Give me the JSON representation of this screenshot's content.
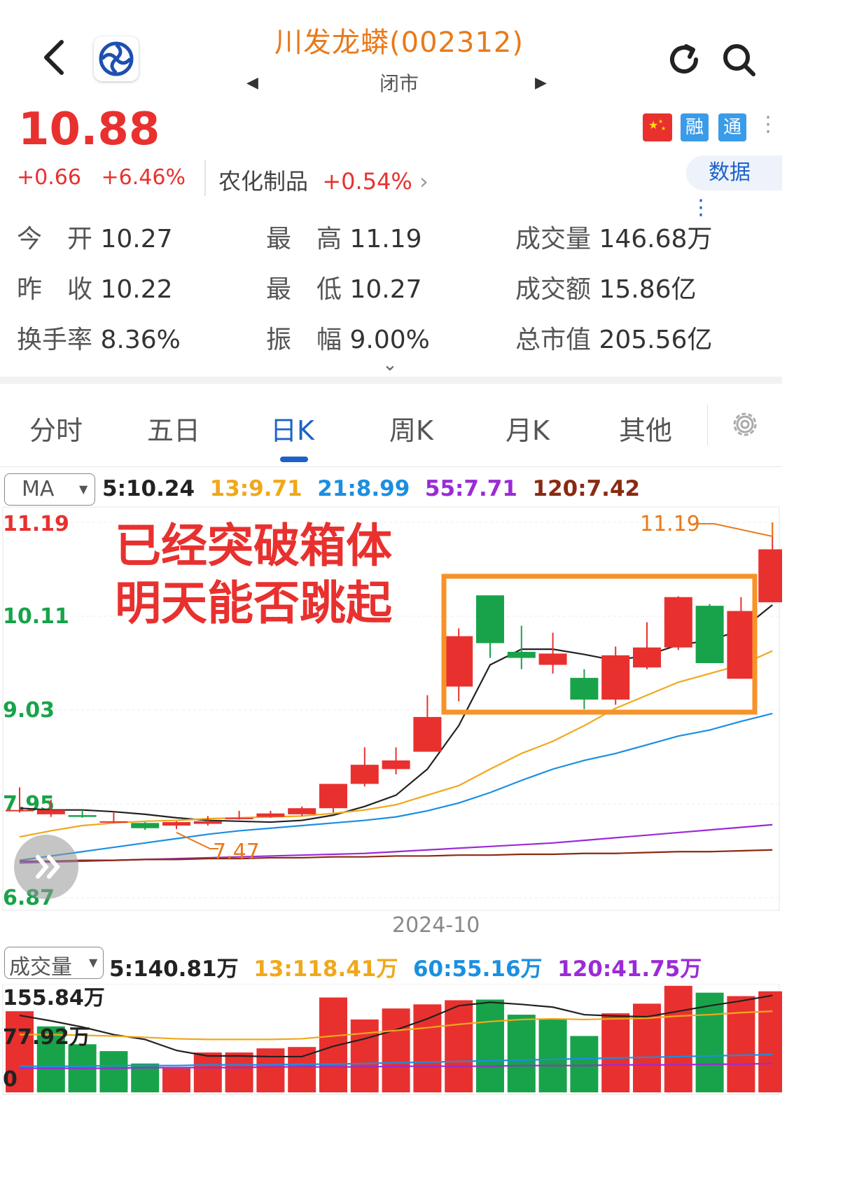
{
  "header": {
    "title": "川发龙蟒(002312)",
    "status": "闭市",
    "prev_arrow": "◀",
    "next_arrow": "▶"
  },
  "quote": {
    "price": "10.88",
    "change": "+0.66",
    "change_pct": "+6.46%",
    "sector_name": "农化制品",
    "sector_pct": "+0.54%",
    "sector_arrow": "›"
  },
  "badges": {
    "rong": "融",
    "tong": "通",
    "more": "⋮"
  },
  "data_button": {
    "label": "数据",
    "icon": "⋮"
  },
  "stats": [
    {
      "label": "今　开",
      "value": "10.27"
    },
    {
      "label": "最　高",
      "value": "11.19"
    },
    {
      "label": "成交量",
      "value": "146.68万"
    },
    {
      "label": "昨　收",
      "value": "10.22"
    },
    {
      "label": "最　低",
      "value": "10.27"
    },
    {
      "label": "成交额",
      "value": "15.86亿"
    },
    {
      "label": "换手率",
      "value": "8.36%"
    },
    {
      "label": "振　幅",
      "value": "9.00%"
    },
    {
      "label": "总市值",
      "value": "205.56亿"
    }
  ],
  "expand_chevron": "⌄",
  "tabs": [
    "分时",
    "五日",
    "日K",
    "周K",
    "月K",
    "其他"
  ],
  "ma_selector": {
    "label": "MA",
    "caret": "▼"
  },
  "ma_values": [
    {
      "text": "5:10.24",
      "color": "#222222"
    },
    {
      "text": "13:9.71",
      "color": "#f0a81b"
    },
    {
      "text": "21:8.99",
      "color": "#1b8fe0"
    },
    {
      "text": "55:7.71",
      "color": "#9b2bd6"
    },
    {
      "text": "120:7.42",
      "color": "#8a2a12"
    }
  ],
  "annotation": {
    "line1": "已经突破箱体",
    "line2": "明天能否跳起"
  },
  "date_label": "2024-10",
  "vol_selector": {
    "label": "成交量",
    "caret": "▼"
  },
  "vol_ma_values": [
    {
      "text": "5:140.81万",
      "color": "#222222"
    },
    {
      "text": "13:118.41万",
      "color": "#f0a81b"
    },
    {
      "text": "60:55.16万",
      "color": "#1b8fe0"
    },
    {
      "text": "120:41.75万",
      "color": "#9b2bd6"
    }
  ],
  "colors": {
    "up": "#e8312f",
    "down": "#18a34a",
    "box": "#f7922a",
    "accent": "#1e62c8"
  },
  "chart_data": {
    "type": "candlestick",
    "y_axis_labels": [
      "11.19",
      "10.11",
      "9.03",
      "7.95",
      "6.87"
    ],
    "ylim": [
      6.87,
      11.19
    ],
    "high_label": "11.19",
    "low_label": "7.47",
    "candles": [
      {
        "o": 7.88,
        "c": 7.88,
        "h": 8.14,
        "l": 7.85
      },
      {
        "o": 7.83,
        "c": 7.88,
        "h": 8.0,
        "l": 7.8
      },
      {
        "o": 7.82,
        "c": 7.8,
        "h": 7.88,
        "l": 7.79
      },
      {
        "o": 7.75,
        "c": 7.75,
        "h": 7.86,
        "l": 7.73
      },
      {
        "o": 7.73,
        "c": 7.67,
        "h": 7.74,
        "l": 7.65
      },
      {
        "o": 7.7,
        "c": 7.74,
        "h": 7.75,
        "l": 7.66
      },
      {
        "o": 7.72,
        "c": 7.75,
        "h": 7.81,
        "l": 7.7
      },
      {
        "o": 7.78,
        "c": 7.79,
        "h": 7.87,
        "l": 7.77
      },
      {
        "o": 7.8,
        "c": 7.84,
        "h": 7.87,
        "l": 7.79
      },
      {
        "o": 7.83,
        "c": 7.9,
        "h": 7.92,
        "l": 7.81
      },
      {
        "o": 7.9,
        "c": 8.18,
        "h": 8.18,
        "l": 7.85
      },
      {
        "o": 8.18,
        "c": 8.4,
        "h": 8.6,
        "l": 8.15
      },
      {
        "o": 8.35,
        "c": 8.45,
        "h": 8.6,
        "l": 8.29
      },
      {
        "o": 8.55,
        "c": 8.95,
        "h": 9.2,
        "l": 8.55
      },
      {
        "o": 9.3,
        "c": 9.88,
        "h": 9.97,
        "l": 9.13
      },
      {
        "o": 10.35,
        "c": 9.8,
        "h": 10.35,
        "l": 9.63
      },
      {
        "o": 9.7,
        "c": 9.63,
        "h": 10.0,
        "l": 9.5
      },
      {
        "o": 9.55,
        "c": 9.68,
        "h": 9.92,
        "l": 9.45
      },
      {
        "o": 9.4,
        "c": 9.15,
        "h": 9.5,
        "l": 9.04
      },
      {
        "o": 9.15,
        "c": 9.66,
        "h": 9.76,
        "l": 9.09
      },
      {
        "o": 9.52,
        "c": 9.75,
        "h": 10.04,
        "l": 9.5
      },
      {
        "o": 9.75,
        "c": 10.33,
        "h": 10.34,
        "l": 9.72
      },
      {
        "o": 10.23,
        "c": 9.57,
        "h": 10.25,
        "l": 9.57
      },
      {
        "o": 9.39,
        "c": 10.17,
        "h": 10.33,
        "l": 9.39
      },
      {
        "o": 10.27,
        "c": 10.88,
        "h": 11.19,
        "l": 10.27
      }
    ],
    "ma_series": [
      {
        "name": "5",
        "color": "#222222",
        "values": [
          7.9,
          7.88,
          7.88,
          7.86,
          7.83,
          7.79,
          7.76,
          7.75,
          7.74,
          7.76,
          7.82,
          7.92,
          8.05,
          8.35,
          8.85,
          9.55,
          9.73,
          9.73,
          9.67,
          9.6,
          9.66,
          9.78,
          9.83,
          9.95,
          10.24
        ]
      },
      {
        "name": "13",
        "color": "#f0a81b",
        "values": [
          7.57,
          7.64,
          7.7,
          7.73,
          7.75,
          7.76,
          7.78,
          7.79,
          7.8,
          7.81,
          7.84,
          7.88,
          7.94,
          8.05,
          8.16,
          8.35,
          8.53,
          8.67,
          8.85,
          9.05,
          9.2,
          9.35,
          9.45,
          9.55,
          9.71
        ]
      },
      {
        "name": "21",
        "color": "#1b8fe0",
        "values": [
          7.3,
          7.35,
          7.4,
          7.45,
          7.5,
          7.55,
          7.6,
          7.64,
          7.67,
          7.7,
          7.73,
          7.76,
          7.8,
          7.87,
          7.96,
          8.08,
          8.22,
          8.35,
          8.45,
          8.53,
          8.63,
          8.73,
          8.8,
          8.9,
          8.99
        ]
      },
      {
        "name": "55",
        "color": "#9b2bd6",
        "values": [
          7.27,
          7.28,
          7.29,
          7.3,
          7.31,
          7.32,
          7.33,
          7.34,
          7.35,
          7.36,
          7.37,
          7.38,
          7.4,
          7.42,
          7.44,
          7.46,
          7.48,
          7.5,
          7.53,
          7.56,
          7.59,
          7.62,
          7.65,
          7.68,
          7.71
        ]
      },
      {
        "name": "120",
        "color": "#8a2a12",
        "values": [
          7.29,
          7.29,
          7.3,
          7.3,
          7.31,
          7.31,
          7.32,
          7.32,
          7.33,
          7.33,
          7.34,
          7.34,
          7.35,
          7.35,
          7.36,
          7.36,
          7.37,
          7.37,
          7.38,
          7.38,
          7.39,
          7.4,
          7.4,
          7.41,
          7.42
        ]
      }
    ],
    "volume": {
      "y_axis_labels": [
        "155.84万",
        "77.92万",
        "0"
      ],
      "ylim": [
        0,
        155.84
      ],
      "bars": [
        {
          "v": 118,
          "up": true
        },
        {
          "v": 96,
          "up": false
        },
        {
          "v": 70,
          "up": false
        },
        {
          "v": 60,
          "up": false
        },
        {
          "v": 42,
          "up": false
        },
        {
          "v": 35,
          "up": true
        },
        {
          "v": 58,
          "up": true
        },
        {
          "v": 58,
          "up": true
        },
        {
          "v": 64,
          "up": true
        },
        {
          "v": 66,
          "up": true
        },
        {
          "v": 138,
          "up": true
        },
        {
          "v": 106,
          "up": true
        },
        {
          "v": 122,
          "up": true
        },
        {
          "v": 128,
          "up": true
        },
        {
          "v": 134,
          "up": true
        },
        {
          "v": 135,
          "up": false
        },
        {
          "v": 113,
          "up": false
        },
        {
          "v": 107,
          "up": false
        },
        {
          "v": 82,
          "up": false
        },
        {
          "v": 115,
          "up": true
        },
        {
          "v": 129,
          "up": true
        },
        {
          "v": 155,
          "up": true
        },
        {
          "v": 145,
          "up": false
        },
        {
          "v": 140,
          "up": true
        },
        {
          "v": 147,
          "up": true
        }
      ],
      "ma_series": [
        {
          "name": "5",
          "color": "#222222",
          "values": [
            112,
            104,
            95,
            84,
            77,
            61,
            53,
            53,
            52,
            52,
            67,
            78,
            91,
            107,
            126,
            131,
            128,
            124,
            113,
            111,
            110,
            118,
            126,
            133,
            141
          ]
        },
        {
          "name": "13",
          "color": "#f0a81b",
          "values": [
            84,
            84,
            83,
            82,
            80,
            78,
            77,
            77,
            77,
            78,
            82,
            86,
            90,
            94,
            99,
            103,
            106,
            107,
            106,
            107,
            108,
            111,
            113,
            116,
            118
          ]
        },
        {
          "name": "60",
          "color": "#1b8fe0",
          "values": [
            38,
            38,
            38,
            39,
            39,
            39,
            40,
            40,
            40,
            41,
            41,
            42,
            43,
            44,
            45,
            46,
            47,
            48,
            49,
            50,
            51,
            52,
            53,
            54,
            55
          ]
        },
        {
          "name": "120",
          "color": "#9b2bd6",
          "values": [
            35,
            35,
            35,
            35,
            36,
            36,
            36,
            36,
            37,
            37,
            37,
            37,
            38,
            38,
            38,
            38,
            39,
            39,
            39,
            40,
            40,
            40,
            41,
            41,
            42
          ]
        }
      ]
    }
  }
}
